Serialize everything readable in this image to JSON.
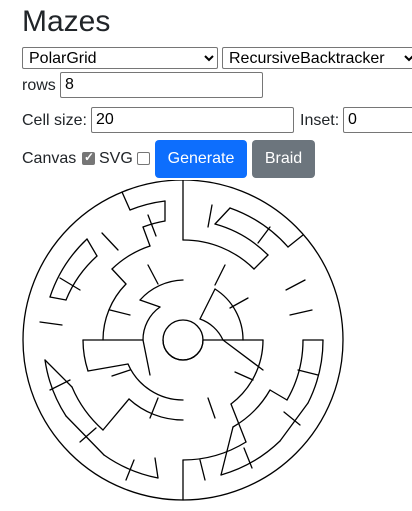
{
  "header": {
    "title": "Mazes"
  },
  "controls": {
    "grid_type": "PolarGrid",
    "algorithm": "RecursiveBacktracker",
    "rows_label": "rows",
    "rows_value": "8",
    "cell_size_label": "Cell size:",
    "cell_size_value": "20",
    "inset_label": "Inset:",
    "inset_value": "0",
    "canvas_label": "Canvas",
    "canvas_checked": true,
    "svg_label": "SVG",
    "svg_checked": false,
    "generate_label": "Generate",
    "braid_label": "Braid"
  },
  "colors": {
    "primary": "#0d6efd",
    "secondary": "#6c757d",
    "maze_stroke": "#000000"
  }
}
